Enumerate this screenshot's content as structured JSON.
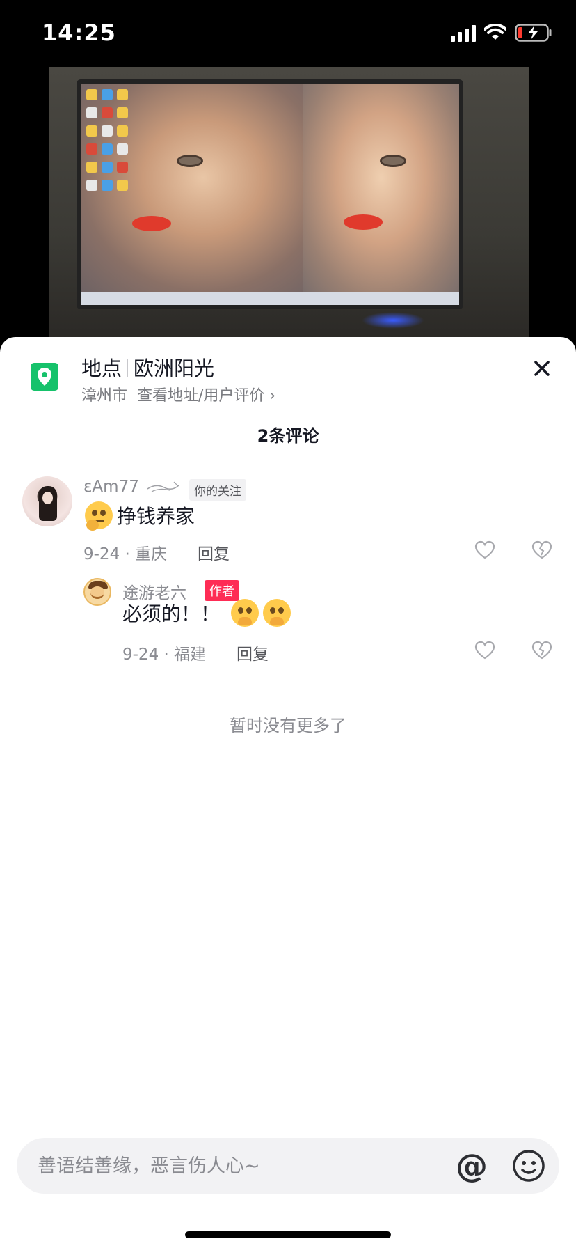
{
  "status_bar": {
    "time": "14:25"
  },
  "location": {
    "label": "地点",
    "name": "欧洲阳光",
    "city": "漳州市",
    "detail_link": "查看地址/用户评价 ›"
  },
  "comments_header": {
    "count_label": "2条评论"
  },
  "comments": [
    {
      "username": "εAm77",
      "follow_badge": "你的关注",
      "text": "挣钱养家",
      "date_location": "9-24 · 重庆",
      "reply_label": "回复",
      "replies": [
        {
          "username": "途游老六",
          "author_badge": "作者",
          "text": "必须的！！",
          "date_location": "9-24 · 福建",
          "reply_label": "回复"
        }
      ]
    }
  ],
  "footer_note": "暂时没有更多了",
  "input": {
    "placeholder": "善语结善缘，恶言伤人心~",
    "value": ""
  },
  "colors": {
    "brand_red": "#fe2c55",
    "location_green": "#16c26b",
    "text_primary": "#161823",
    "text_secondary": "#8a8b91"
  },
  "icons": [
    "location-pin-icon",
    "close-icon",
    "heart-icon",
    "dislike-icon",
    "at-icon",
    "emoji-icon",
    "signal-icon",
    "wifi-icon",
    "battery-icon"
  ]
}
